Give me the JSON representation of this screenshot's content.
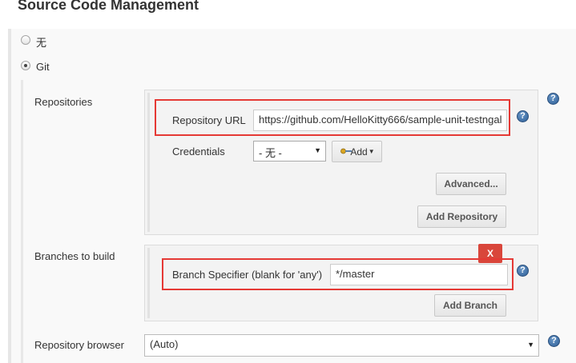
{
  "section": {
    "title": "Source Code Management"
  },
  "scm_options": [
    {
      "label": "无",
      "checked": false
    },
    {
      "label": "Git",
      "checked": true
    }
  ],
  "repositories": {
    "label": "Repositories",
    "url_label": "Repository URL",
    "url_value": "https://github.com/HelloKitty666/sample-unit-testngal",
    "credentials_label": "Credentials",
    "credentials_value": "- 无 -",
    "add_label": "Add",
    "advanced_label": "Advanced...",
    "add_repository_label": "Add Repository"
  },
  "branches": {
    "label": "Branches to build",
    "delete_label": "X",
    "specifier_label": "Branch Specifier (blank for 'any')",
    "specifier_value": "*/master",
    "add_branch_label": "Add Branch"
  },
  "browser": {
    "label": "Repository browser",
    "value": "(Auto)"
  },
  "help": {
    "glyph": "?"
  },
  "colors": {
    "highlight": "#e53935",
    "delete_button": "#d9463b",
    "help_icon": "#2e5f97"
  }
}
